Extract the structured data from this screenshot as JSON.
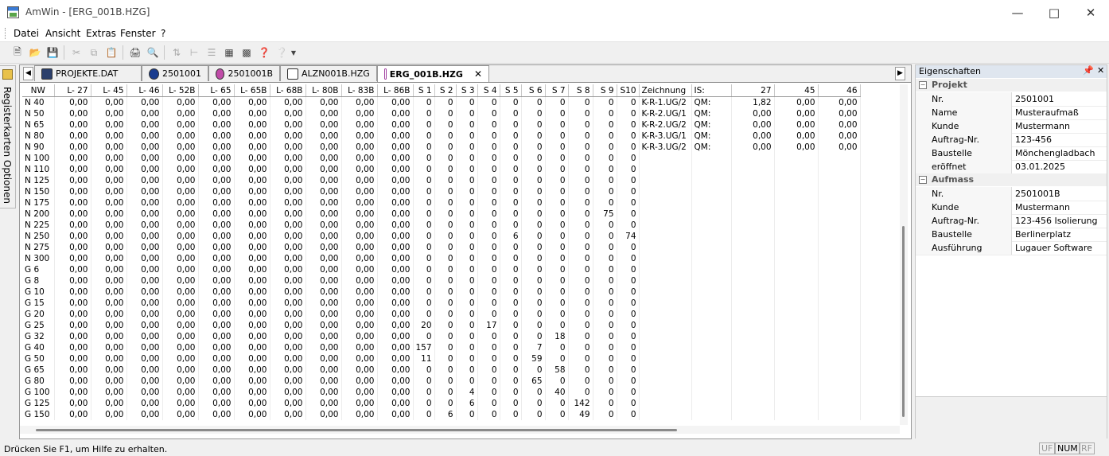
{
  "window": {
    "title": "AmWin - [ERG_001B.HZG]"
  },
  "menu": [
    "Datei",
    "Ansicht",
    "Extras",
    "Fenster",
    "?"
  ],
  "sidetab": {
    "label": "Registerkarten Optionen"
  },
  "tabs": [
    {
      "label": "PROJEKTE.DAT",
      "active": false
    },
    {
      "label": "2501001",
      "active": false
    },
    {
      "label": "2501001B",
      "active": false
    },
    {
      "label": "ALZN001B.HZG",
      "active": false
    },
    {
      "label": "ERG_001B.HZG",
      "active": true
    }
  ],
  "grid": {
    "headers": [
      "NW",
      "L- 27",
      "L- 45",
      "L- 46",
      "L- 52B",
      "L- 65",
      "L- 65B",
      "L- 68B",
      "L- 80B",
      "L- 83B",
      "L- 86B",
      "S 1",
      "S 2",
      "S 3",
      "S 4",
      "S 5",
      "S 6",
      "S 7",
      "S 8",
      "S 9",
      "S10",
      "Zeichnung",
      "IS:",
      "27",
      "45",
      "46"
    ],
    "nw": [
      "N 40",
      "N 50",
      "N 65",
      "N 80",
      "N 90",
      "N 100",
      "N 110",
      "N 125",
      "N 150",
      "N 175",
      "N 200",
      "N 225",
      "N 250",
      "N 275",
      "N 300",
      "G 6",
      "G 8",
      "G 10",
      "G 15",
      "G 20",
      "G 25",
      "G 32",
      "G 40",
      "G 50",
      "G 65",
      "G 80",
      "G 100",
      "G 125",
      "G 150"
    ],
    "l_value": "0,00",
    "s_values": [
      [
        0,
        0,
        0,
        0,
        0,
        0,
        0,
        0,
        0,
        0
      ],
      [
        0,
        0,
        0,
        0,
        0,
        0,
        0,
        0,
        0,
        0
      ],
      [
        0,
        0,
        0,
        0,
        0,
        0,
        0,
        0,
        0,
        0
      ],
      [
        0,
        0,
        0,
        0,
        0,
        0,
        0,
        0,
        0,
        0
      ],
      [
        0,
        0,
        0,
        0,
        0,
        0,
        0,
        0,
        0,
        0
      ],
      [
        0,
        0,
        0,
        0,
        0,
        0,
        0,
        0,
        0,
        0
      ],
      [
        0,
        0,
        0,
        0,
        0,
        0,
        0,
        0,
        0,
        0
      ],
      [
        0,
        0,
        0,
        0,
        0,
        0,
        0,
        0,
        0,
        0
      ],
      [
        0,
        0,
        0,
        0,
        0,
        0,
        0,
        0,
        0,
        0
      ],
      [
        0,
        0,
        0,
        0,
        0,
        0,
        0,
        0,
        0,
        0
      ],
      [
        0,
        0,
        0,
        0,
        0,
        0,
        0,
        0,
        75,
        0
      ],
      [
        0,
        0,
        0,
        0,
        0,
        0,
        0,
        0,
        0,
        0
      ],
      [
        0,
        0,
        0,
        0,
        6,
        0,
        0,
        0,
        0,
        74
      ],
      [
        0,
        0,
        0,
        0,
        0,
        0,
        0,
        0,
        0,
        0
      ],
      [
        0,
        0,
        0,
        0,
        0,
        0,
        0,
        0,
        0,
        0
      ],
      [
        0,
        0,
        0,
        0,
        0,
        0,
        0,
        0,
        0,
        0
      ],
      [
        0,
        0,
        0,
        0,
        0,
        0,
        0,
        0,
        0,
        0
      ],
      [
        0,
        0,
        0,
        0,
        0,
        0,
        0,
        0,
        0,
        0
      ],
      [
        0,
        0,
        0,
        0,
        0,
        0,
        0,
        0,
        0,
        0
      ],
      [
        0,
        0,
        0,
        0,
        0,
        0,
        0,
        0,
        0,
        0
      ],
      [
        20,
        0,
        0,
        17,
        0,
        0,
        0,
        0,
        0,
        0
      ],
      [
        0,
        0,
        0,
        0,
        0,
        0,
        18,
        0,
        0,
        0
      ],
      [
        157,
        0,
        0,
        0,
        0,
        7,
        0,
        0,
        0,
        0
      ],
      [
        11,
        0,
        0,
        0,
        0,
        59,
        0,
        0,
        0,
        0
      ],
      [
        0,
        0,
        0,
        0,
        0,
        0,
        58,
        0,
        0,
        0
      ],
      [
        0,
        0,
        0,
        0,
        0,
        65,
        0,
        0,
        0,
        0
      ],
      [
        0,
        0,
        4,
        0,
        0,
        0,
        40,
        0,
        0,
        0
      ],
      [
        0,
        0,
        6,
        0,
        0,
        0,
        0,
        142,
        0,
        0
      ],
      [
        0,
        6,
        0,
        0,
        0,
        0,
        0,
        49,
        0,
        0
      ]
    ],
    "zeichnung": [
      [
        "K-R-1.UG/2",
        "QM:",
        "1,82",
        "0,00",
        "0,00"
      ],
      [
        "K-R-2.UG/1",
        "QM:",
        "0,00",
        "0,00",
        "0,00"
      ],
      [
        "K-R-2.UG/2",
        "QM:",
        "0,00",
        "0,00",
        "0,00"
      ],
      [
        "K-R-3.UG/1",
        "QM:",
        "0,00",
        "0,00",
        "0,00"
      ],
      [
        "K-R-3.UG/2",
        "QM:",
        "0,00",
        "0,00",
        "0,00"
      ]
    ]
  },
  "properties": {
    "title": "Eigenschaften",
    "pin": "📌",
    "close": "✕",
    "categories": [
      {
        "name": "Projekt",
        "rows": [
          {
            "label": "Nr.",
            "value": "2501001"
          },
          {
            "label": "Name",
            "value": "Musteraufmaß"
          },
          {
            "label": "Kunde",
            "value": "Mustermann"
          },
          {
            "label": "Auftrag-Nr.",
            "value": "123-456"
          },
          {
            "label": "Baustelle",
            "value": "Mönchengladbach"
          },
          {
            "label": "eröffnet",
            "value": "03.01.2025"
          }
        ]
      },
      {
        "name": "Aufmass",
        "rows": [
          {
            "label": "Nr.",
            "value": "2501001B"
          },
          {
            "label": "Kunde",
            "value": "Mustermann"
          },
          {
            "label": "Auftrag-Nr.",
            "value": "123-456 Isolierung"
          },
          {
            "label": "Baustelle",
            "value": "Berlinerplatz"
          },
          {
            "label": "Ausführung",
            "value": "Lugauer Software"
          }
        ]
      }
    ]
  },
  "status": {
    "text": "Drücken Sie F1, um Hilfe zu erhalten.",
    "indicators": [
      {
        "label": "UF",
        "on": false
      },
      {
        "label": "NUM",
        "on": true
      },
      {
        "label": "RF",
        "on": false
      }
    ]
  }
}
